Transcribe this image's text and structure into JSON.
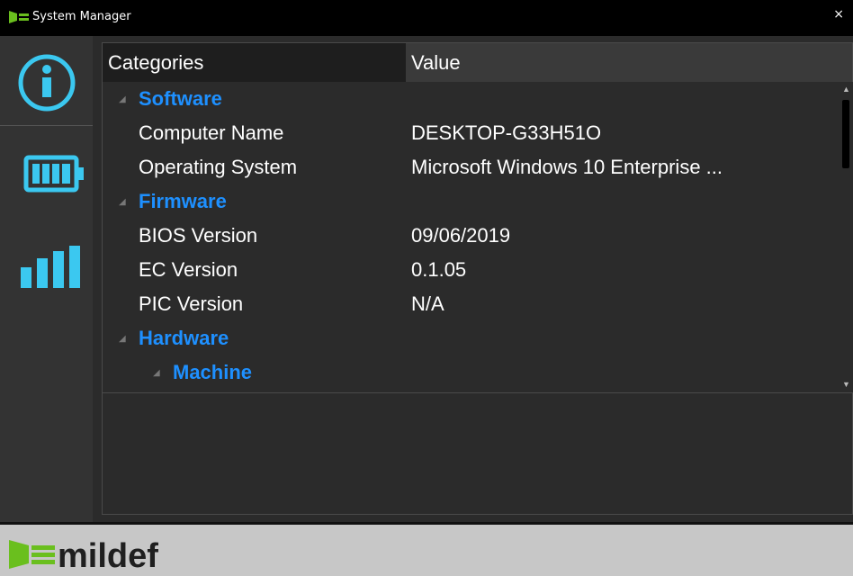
{
  "window": {
    "title": "System Manager",
    "close_label": "×"
  },
  "sidebar": {
    "items": [
      {
        "name": "info",
        "icon": "info-icon"
      },
      {
        "name": "battery",
        "icon": "battery-icon"
      },
      {
        "name": "signal",
        "icon": "signal-bars-icon"
      }
    ],
    "accent_color": "#3bc8f0"
  },
  "grid": {
    "headers": {
      "category": "Categories",
      "value": "Value"
    },
    "rows": [
      {
        "level": 0,
        "type": "group",
        "category": "Software",
        "value": ""
      },
      {
        "level": 1,
        "type": "item",
        "category": "Computer Name",
        "value": "DESKTOP-G33H51O"
      },
      {
        "level": 1,
        "type": "item",
        "category": "Operating System",
        "value": "Microsoft Windows 10 Enterprise ..."
      },
      {
        "level": 0,
        "type": "group",
        "category": "Firmware",
        "value": ""
      },
      {
        "level": 1,
        "type": "item",
        "category": "BIOS Version",
        "value": "09/06/2019"
      },
      {
        "level": 1,
        "type": "item",
        "category": "EC Version",
        "value": "0.1.05"
      },
      {
        "level": 1,
        "type": "item",
        "category": "PIC Version",
        "value": "N/A"
      },
      {
        "level": 0,
        "type": "group",
        "category": "Hardware",
        "value": ""
      },
      {
        "level": 1,
        "type": "group",
        "category": "Machine",
        "value": ""
      }
    ],
    "group_color": "#1e90ff",
    "expand_glyph": "◢"
  },
  "footer": {
    "logo_text": "mildef",
    "logo_colors": {
      "green": "#6abf1e",
      "dark": "#1f1f1f"
    }
  }
}
